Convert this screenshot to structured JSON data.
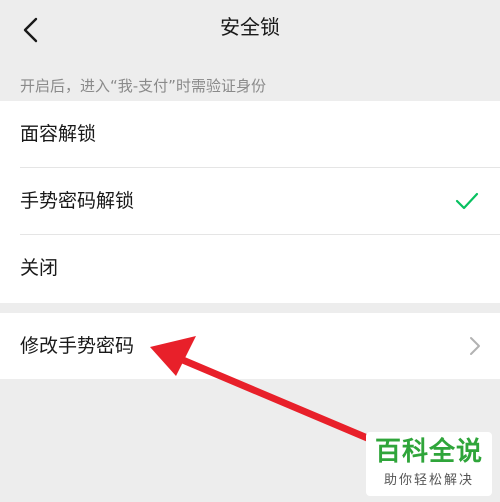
{
  "nav": {
    "title": "安全锁",
    "back_icon": "chevron-left-icon"
  },
  "hint": "开启后，进入“我-支付”时需验证身份",
  "lock_options": [
    {
      "label": "面容解锁",
      "selected": false
    },
    {
      "label": "手势密码解锁",
      "selected": true
    },
    {
      "label": "关闭",
      "selected": false
    }
  ],
  "modify": {
    "label": "修改手势密码",
    "icon": "chevron-right-icon"
  },
  "colors": {
    "accent_check": "#07c160",
    "annotation_arrow": "#e8202a",
    "watermark_green": "#2fa53a"
  },
  "watermark": {
    "title": "百科全说",
    "subtitle": "助你轻松解决"
  }
}
